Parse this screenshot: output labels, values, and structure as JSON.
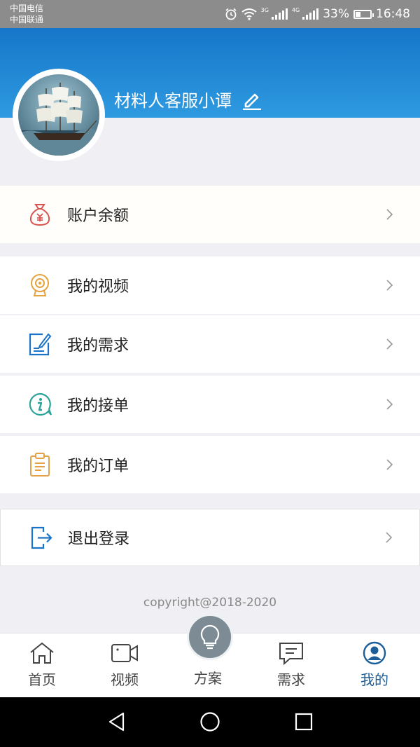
{
  "status_bar": {
    "carrier_1": "中国电信",
    "carrier_2": "中国联通",
    "net_1": "3G",
    "net_2": "4G",
    "battery": "33%",
    "battery_level": 0.33,
    "time": "16:48"
  },
  "profile": {
    "username": "材料人客服小谭",
    "edit_icon": "pencil-icon"
  },
  "menu": {
    "balance": {
      "label": "账户余额",
      "icon": "money-bag-icon"
    },
    "videos": {
      "label": "我的视频",
      "icon": "webcam-icon"
    },
    "requests": {
      "label": "我的需求",
      "icon": "edit-document-icon"
    },
    "accepted": {
      "label": "我的接单",
      "icon": "info-chat-icon"
    },
    "orders": {
      "label": "我的订单",
      "icon": "clipboard-icon"
    },
    "logout": {
      "label": "退出登录",
      "icon": "logout-icon"
    }
  },
  "copyright": "copyright@2018-2020",
  "tabbar": {
    "home": "首页",
    "video": "视频",
    "plan": "方案",
    "demand": "需求",
    "mine": "我的",
    "active": "mine"
  },
  "colors": {
    "header_top": "#1676c9",
    "header_bottom": "#2e9ae0",
    "active_tab": "#1e5e98",
    "balance_icon": "#d9534f",
    "video_icon": "#e6a23c",
    "request_icon": "#1a73c6",
    "accepted_icon": "#2aa39a",
    "orders_icon": "#e3a24a",
    "logout_icon": "#1a73c6"
  }
}
